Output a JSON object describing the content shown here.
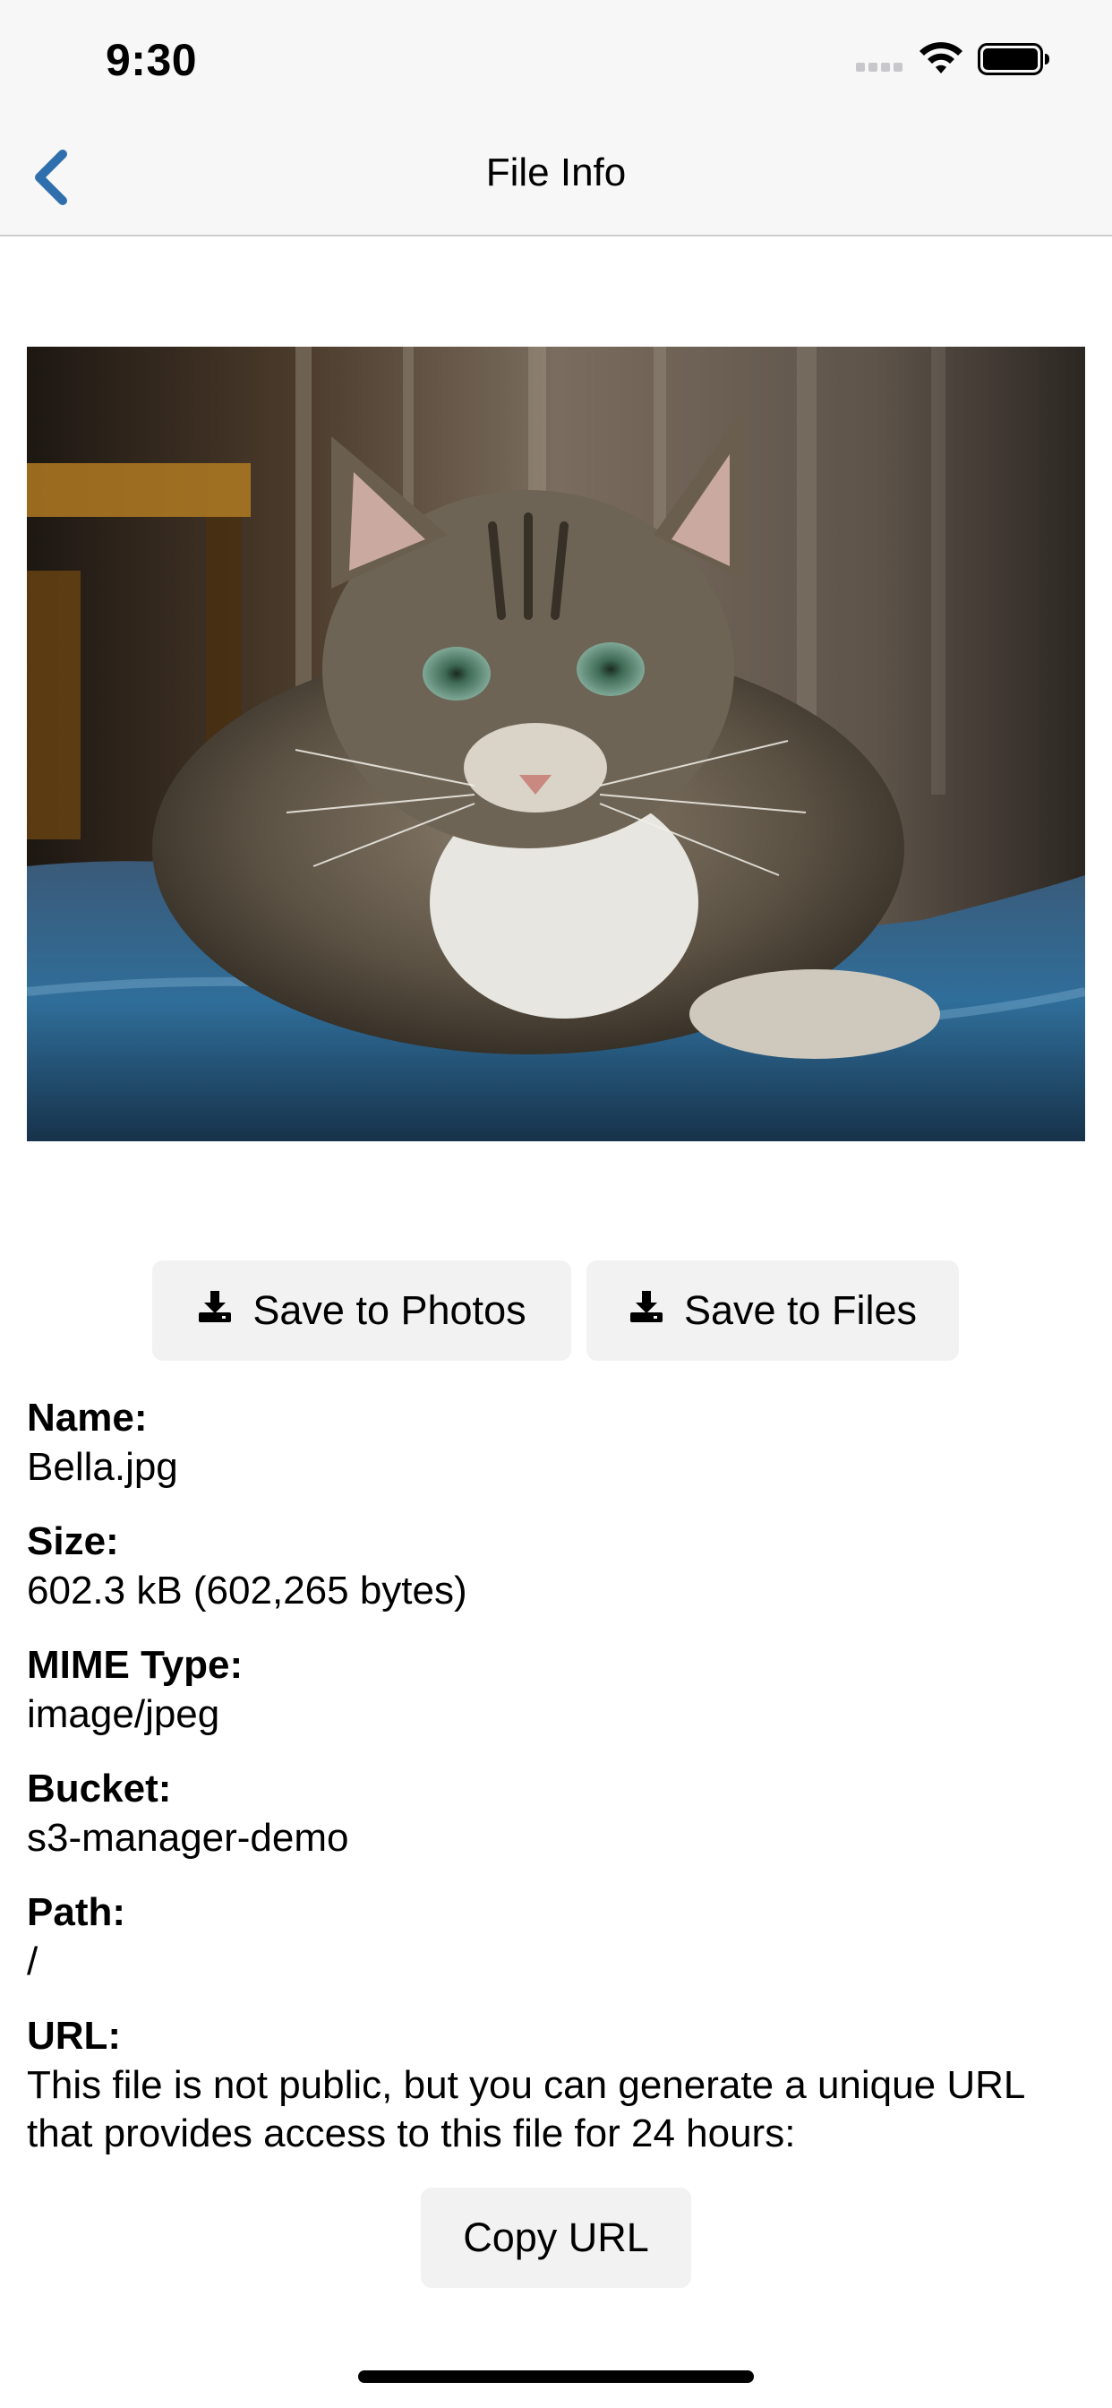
{
  "status_bar": {
    "time": "9:30",
    "icons": [
      "signal-icon",
      "wifi-icon",
      "battery-icon"
    ]
  },
  "nav": {
    "title": "File Info",
    "back_icon": "chevron-left-icon",
    "accent": "#2f6fad"
  },
  "preview": {
    "subject": "cat photo"
  },
  "actions": {
    "save_photos": "Save to Photos",
    "save_files": "Save to Files",
    "icon": "download-icon"
  },
  "info": {
    "name_label": "Name:",
    "name_value": "Bella.jpg",
    "size_label": "Size:",
    "size_value": "602.3 kB (602,265 bytes)",
    "mime_label": "MIME Type:",
    "mime_value": "image/jpeg",
    "bucket_label": "Bucket:",
    "bucket_value": "s3-manager-demo",
    "path_label": "Path:",
    "path_value": "/",
    "url_label": "URL:",
    "url_value": "This file is not public, but you can generate a unique URL that provides access to this file for 24 hours:"
  },
  "copy_url": {
    "label": "Copy URL"
  }
}
